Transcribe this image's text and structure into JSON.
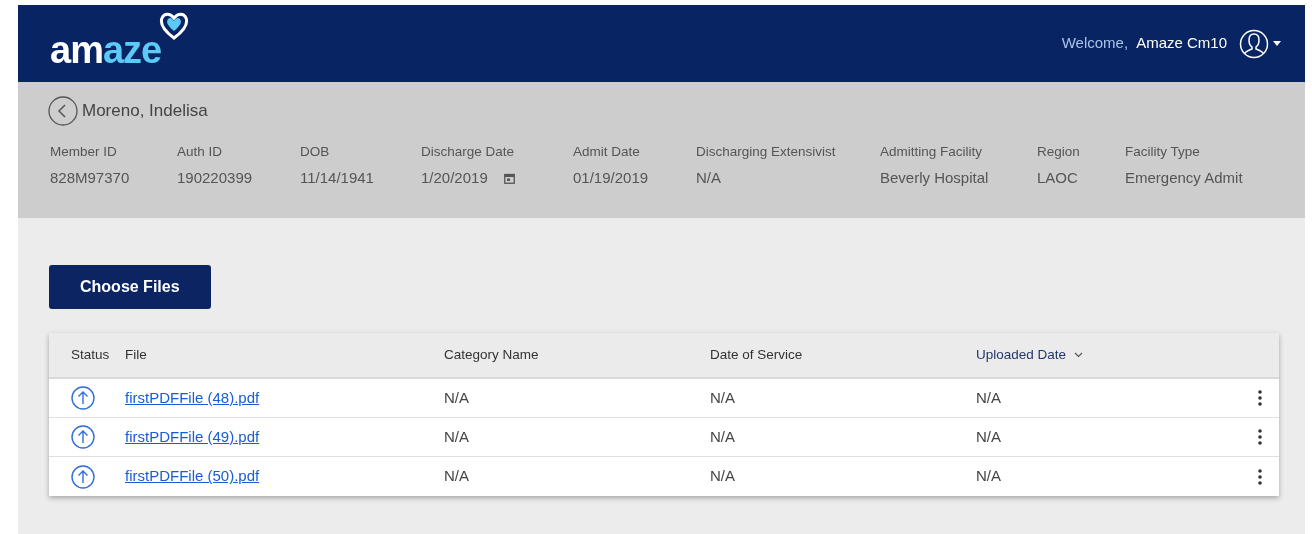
{
  "header": {
    "logo": {
      "part_1": "am",
      "part_2": "aze"
    },
    "welcome": "Welcome,",
    "user": "Amaze Cm10"
  },
  "patient": {
    "name": "Moreno, Indelisa",
    "fields": [
      {
        "label": "Member ID",
        "value": "828M97370",
        "kind": "text"
      },
      {
        "label": "Auth ID",
        "value": "190220399",
        "kind": "text"
      },
      {
        "label": "DOB",
        "value": "11/14/1941",
        "kind": "text"
      },
      {
        "label": "Discharge Date",
        "value": "1/20/2019",
        "kind": "date"
      },
      {
        "label": "Admit Date",
        "value": "01/19/2019",
        "kind": "text"
      },
      {
        "label": "Discharging Extensivist",
        "value": "N/A",
        "kind": "text"
      },
      {
        "label": "Admitting Facility",
        "value": "Beverly Hospital",
        "kind": "text"
      },
      {
        "label": "Region",
        "value": "LAOC",
        "kind": "text"
      },
      {
        "label": "Facility Type",
        "value": "Emergency Admit",
        "kind": "text"
      }
    ]
  },
  "choose_button": "Choose Files",
  "table": {
    "columns": [
      {
        "label": "Status",
        "sorted": false
      },
      {
        "label": "File",
        "sorted": false
      },
      {
        "label": "Category Name",
        "sorted": false
      },
      {
        "label": "Date of Service",
        "sorted": false
      },
      {
        "label": "Uploaded Date",
        "sorted": true
      }
    ],
    "rows": [
      {
        "file": "firstPDFFile (48).pdf",
        "category": "N/A",
        "date_of_service": "N/A",
        "uploaded_date": "N/A"
      },
      {
        "file": "firstPDFFile (49).pdf",
        "category": "N/A",
        "date_of_service": "N/A",
        "uploaded_date": "N/A"
      },
      {
        "file": "firstPDFFile (50).pdf",
        "category": "N/A",
        "date_of_service": "N/A",
        "uploaded_date": "N/A"
      }
    ]
  }
}
